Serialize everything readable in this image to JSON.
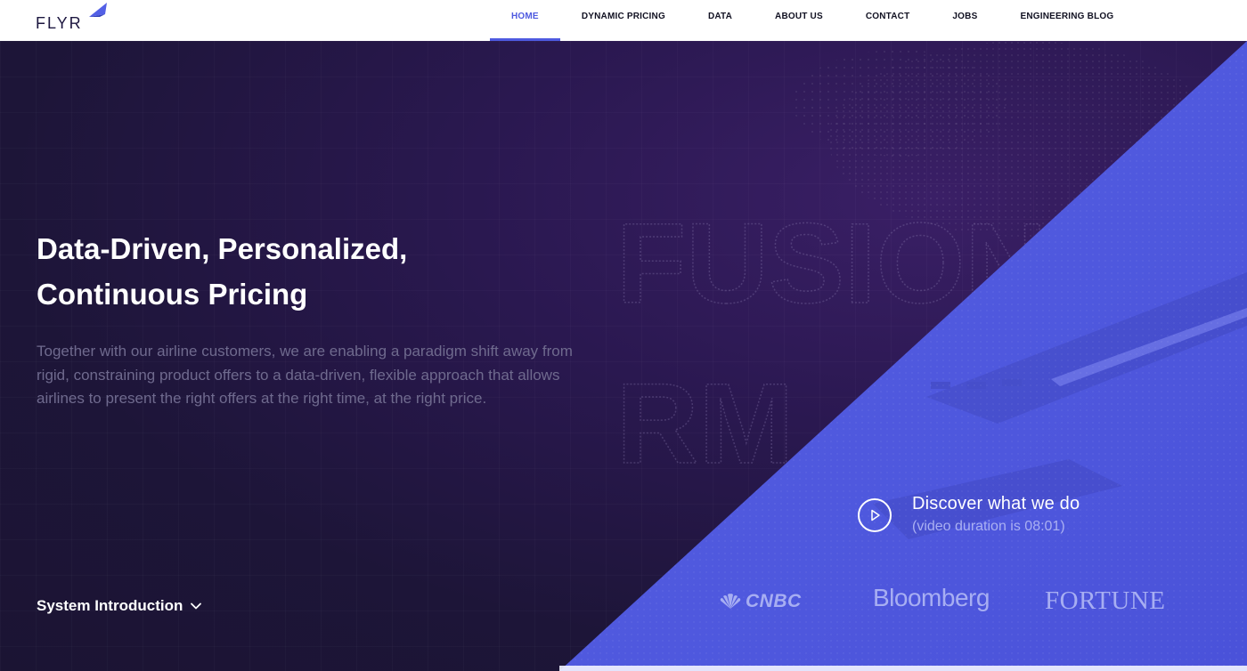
{
  "brand": {
    "logo_text": "FLYR",
    "accent_color": "#4e5ae0"
  },
  "nav": {
    "items": [
      {
        "label": "HOME",
        "active": true
      },
      {
        "label": "DYNAMIC PRICING"
      },
      {
        "label": "DATA"
      },
      {
        "label": "ABOUT US"
      },
      {
        "label": "CONTACT"
      },
      {
        "label": "JOBS"
      },
      {
        "label": "ENGINEERING BLOG"
      }
    ]
  },
  "hero": {
    "headline_line1": "Data-Driven, Personalized,",
    "headline_line2": "Continuous Pricing",
    "intro": "Together with our airline customers, we are enabling a paradigm shift away from rigid, constraining product offers to a data-driven, flexible approach that allows airlines to present the right offers at the right time, at the right price.",
    "background_words": [
      "FUSION",
      "RM"
    ],
    "system_intro_label": "System Introduction",
    "video": {
      "title": "Discover what we do",
      "duration": "(video duration is 08:01)"
    },
    "press": [
      "CNBC",
      "Bloomberg",
      "FORTUNE"
    ],
    "colors": {
      "dark_bg": "#1d1537",
      "diagonal_panel": "#4f58df"
    }
  },
  "icons": {
    "logo_wing": "wing-icon",
    "system_intro": "chevron-down-icon",
    "video": "play-icon",
    "cnbc": "peacock-icon"
  }
}
